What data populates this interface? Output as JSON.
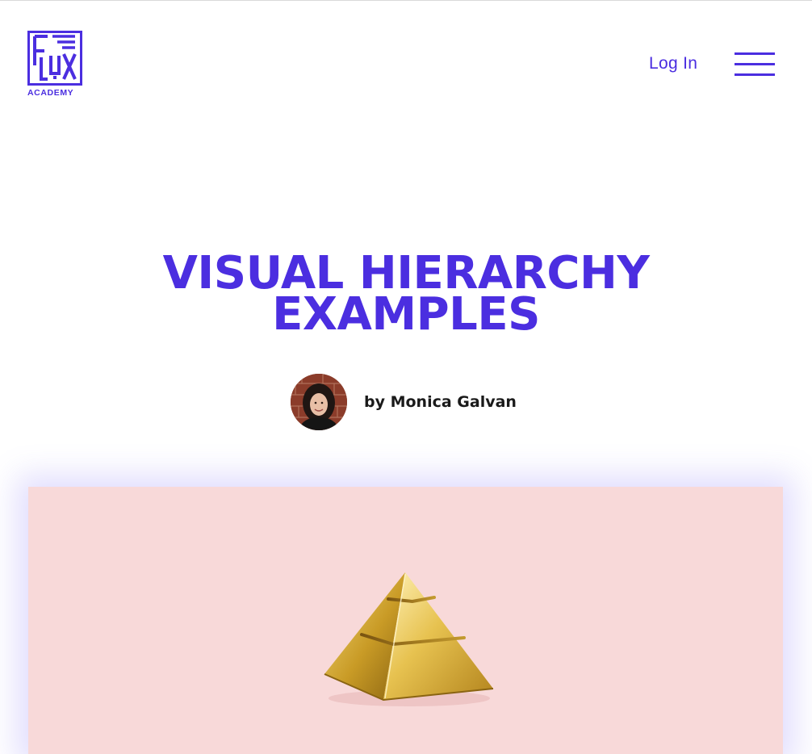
{
  "header": {
    "logo_letters": "FLUX",
    "logo_word": "ACADEMY",
    "login_label": "Log In",
    "menu_icon": "hamburger-menu-icon"
  },
  "article": {
    "title_line1": "VISUAL HIERARCHY",
    "title_line2": "EXAMPLES",
    "author_prefix": "by",
    "author_name": "Monica Galvan",
    "byline": "by Monica Galvan"
  },
  "hero": {
    "background_color": "#f8d9d9",
    "image": "gold-pyramid-illustration"
  },
  "colors": {
    "brand": "#4b2ee0",
    "text": "#1a1a1a",
    "hero_bg": "#f8d9d9",
    "gold": "#d9b640"
  }
}
